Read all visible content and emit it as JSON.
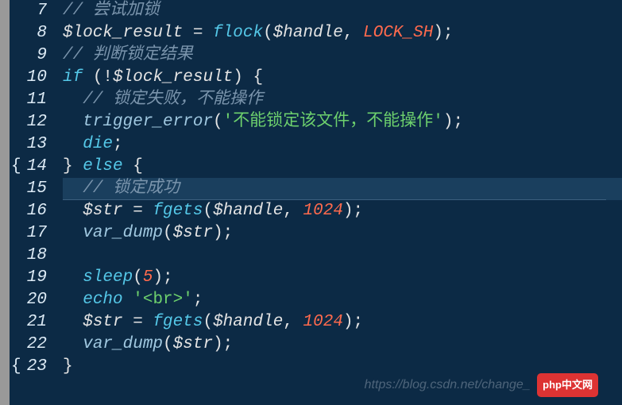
{
  "lines": [
    {
      "num": 7,
      "brace": "",
      "hl": false,
      "tokens": [
        [
          "comment",
          "// 尝试加锁"
        ]
      ]
    },
    {
      "num": 8,
      "brace": "",
      "hl": false,
      "tokens": [
        [
          "var",
          "$lock_result"
        ],
        [
          "punct",
          " = "
        ],
        [
          "func",
          "flock"
        ],
        [
          "punct",
          "("
        ],
        [
          "var",
          "$handle"
        ],
        [
          "punct",
          ", "
        ],
        [
          "const",
          "LOCK_SH"
        ],
        [
          "punct",
          ");"
        ]
      ]
    },
    {
      "num": 9,
      "brace": "",
      "hl": false,
      "tokens": [
        [
          "comment",
          "// 判断锁定结果"
        ]
      ]
    },
    {
      "num": 10,
      "brace": "",
      "hl": false,
      "tokens": [
        [
          "keyword",
          "if"
        ],
        [
          "punct",
          " (!"
        ],
        [
          "var",
          "$lock_result"
        ],
        [
          "punct",
          ") "
        ],
        [
          "brace",
          "{"
        ]
      ]
    },
    {
      "num": 11,
      "brace": "",
      "hl": false,
      "indent": 1,
      "tokens": [
        [
          "comment",
          "// 锁定失败，不能操作"
        ]
      ]
    },
    {
      "num": 12,
      "brace": "",
      "hl": false,
      "indent": 1,
      "tokens": [
        [
          "funcname",
          "trigger_error"
        ],
        [
          "punct",
          "("
        ],
        [
          "string",
          "'不能锁定该文件，不能操作'"
        ],
        [
          "punct",
          ");"
        ]
      ]
    },
    {
      "num": 13,
      "brace": "",
      "hl": false,
      "indent": 1,
      "tokens": [
        [
          "keyword",
          "die"
        ],
        [
          "punct",
          ";"
        ]
      ]
    },
    {
      "num": 14,
      "brace": "{",
      "hl": false,
      "tokens": [
        [
          "brace",
          "}"
        ],
        [
          "punct",
          " "
        ],
        [
          "keyword",
          "else"
        ],
        [
          "punct",
          " "
        ],
        [
          "brace",
          "{"
        ]
      ]
    },
    {
      "num": 15,
      "brace": "",
      "hl": true,
      "indent": 1,
      "tokens": [
        [
          "comment",
          "// 锁定成功"
        ]
      ]
    },
    {
      "num": 16,
      "brace": "",
      "hl": false,
      "indent": 1,
      "tokens": [
        [
          "var",
          "$str"
        ],
        [
          "punct",
          " = "
        ],
        [
          "func",
          "fgets"
        ],
        [
          "punct",
          "("
        ],
        [
          "var",
          "$handle"
        ],
        [
          "punct",
          ", "
        ],
        [
          "number",
          "1024"
        ],
        [
          "punct",
          ");"
        ]
      ]
    },
    {
      "num": 17,
      "brace": "",
      "hl": false,
      "indent": 1,
      "tokens": [
        [
          "funcname",
          "var_dump"
        ],
        [
          "punct",
          "("
        ],
        [
          "var",
          "$str"
        ],
        [
          "punct",
          ");"
        ]
      ]
    },
    {
      "num": 18,
      "brace": "",
      "hl": false,
      "indent": 1,
      "tokens": []
    },
    {
      "num": 19,
      "brace": "",
      "hl": false,
      "indent": 1,
      "tokens": [
        [
          "func",
          "sleep"
        ],
        [
          "punct",
          "("
        ],
        [
          "number",
          "5"
        ],
        [
          "punct",
          ");"
        ]
      ]
    },
    {
      "num": 20,
      "brace": "",
      "hl": false,
      "indent": 1,
      "tokens": [
        [
          "keyword",
          "echo"
        ],
        [
          "punct",
          " "
        ],
        [
          "string",
          "'<br>'"
        ],
        [
          "punct",
          ";"
        ]
      ]
    },
    {
      "num": 21,
      "brace": "",
      "hl": false,
      "indent": 1,
      "tokens": [
        [
          "var",
          "$str"
        ],
        [
          "punct",
          " = "
        ],
        [
          "func",
          "fgets"
        ],
        [
          "punct",
          "("
        ],
        [
          "var",
          "$handle"
        ],
        [
          "punct",
          ", "
        ],
        [
          "number",
          "1024"
        ],
        [
          "punct",
          ");"
        ]
      ]
    },
    {
      "num": 22,
      "brace": "",
      "hl": false,
      "indent": 1,
      "tokens": [
        [
          "funcname",
          "var_dump"
        ],
        [
          "punct",
          "("
        ],
        [
          "var",
          "$str"
        ],
        [
          "punct",
          ");"
        ]
      ]
    },
    {
      "num": 23,
      "brace": "{",
      "hl": false,
      "tokens": [
        [
          "brace",
          "}"
        ]
      ]
    }
  ],
  "watermark_url": "https://blog.csdn.net/change_",
  "watermark_brand_a": "php",
  "watermark_brand_b": "中文网"
}
